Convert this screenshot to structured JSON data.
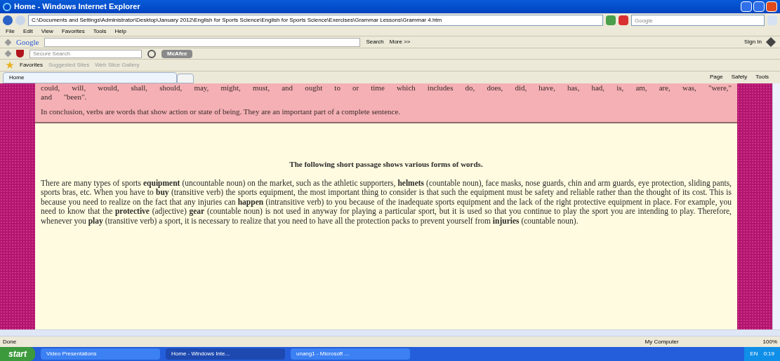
{
  "window": {
    "title": "Home - Windows Internet Explorer"
  },
  "address_bar": {
    "value": "C:\\Documents and Settings\\Administrator\\Desktop\\January 2012\\English for Sports Science\\English for Sports Science\\Exercises\\Grammar Lessons\\Grammar 4.htm"
  },
  "search_box": {
    "placeholder": "Google"
  },
  "menu": [
    "File",
    "Edit",
    "View",
    "Favorites",
    "Tools",
    "Help"
  ],
  "google_toolbar": {
    "logo": "Google",
    "search_label": "Search",
    "more_label": "More >>",
    "sign_in": "Sign In"
  },
  "mcafee_toolbar": {
    "placeholder": "Secure Search",
    "brand": "McAfee"
  },
  "favorites_bar": {
    "label": "Favorites",
    "links": [
      "Suggested Sites",
      "Web Slice Gallery"
    ]
  },
  "tabs": [
    {
      "label": "Home",
      "selected": true
    }
  ],
  "command_bar": [
    "Page",
    "Safety",
    "Tools"
  ],
  "pink_section": {
    "paragraphs": [
      "could, will, would, shall, should, may, might, must, and ought to or time which includes do, does, did, have, has, had, is, am, are, was, \"were,\" and \"been\".",
      "In conclusion, verbs are words that show action or state of being. They are an important part of a complete sentence."
    ]
  },
  "passage": {
    "heading": "The following short passage shows various forms of words.",
    "text": "There are many types of sports **equipment** (uncountable noun) on the market, such as the athletic supporters, **helmets** (countable noun), face masks, nose guards, chin and arm guards, eye protection, sliding pants, sports bras, etc. When you have to **buy** (transitive verb) the sports equipment, the most important thing to consider is that such the equipment must be safety and reliable rather than the thought of its cost. This is because you need to realize on the fact that any injuries can **happen** (intransitive verb) to you because of the inadequate sports equipment and the lack of the right protective equipment in place. For example, you need to know that the **protective** (adjective) **gear** (countable noun) is not used in anyway for playing a particular sport, but it is used so that you continue to play the sport you are intending to play. Therefore, whenever you **play** (transitive verb) a sport, it is necessary to realize that you need to have all the protection packs to prevent yourself from **injuries** (countable noun)."
  },
  "status_bar": {
    "status": "Done",
    "zone": "My Computer",
    "zoom": "100%"
  },
  "taskbar": {
    "start": "start",
    "items": [
      {
        "label": "Video Presentations",
        "selected": false
      },
      {
        "label": "Home - Windows Inte...",
        "selected": true
      },
      {
        "label": "unang1 - Microsoft ...",
        "selected": false
      }
    ],
    "language": "EN",
    "clock": "0:19"
  }
}
